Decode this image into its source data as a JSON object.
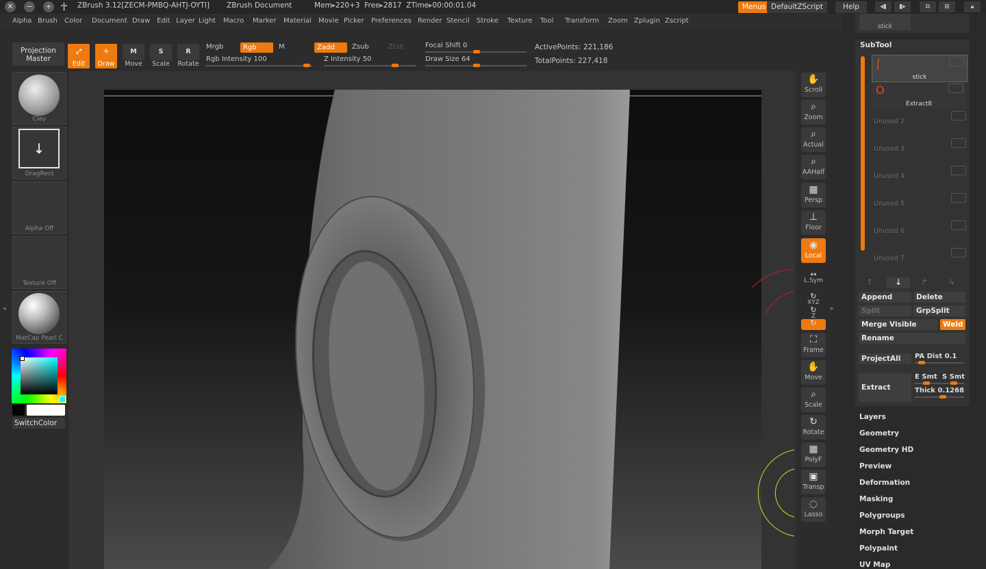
{
  "titlebar": {
    "app_title": "ZBrush 3.12[ZECM-PMBQ-AHTJ-OYTI]",
    "document": "ZBrush Document",
    "mem_label": "Mem",
    "mem_value": "220+3",
    "free_label": "Free",
    "free_value": "2817",
    "ztime_label": "ZTime",
    "ztime_value": "00:00:01.04",
    "menus_btn": "Menus",
    "script_btn": "DefaultZScript",
    "help_btn": "Help"
  },
  "menubar": [
    "Alpha",
    "Brush",
    "Color",
    "Document",
    "Draw",
    "Edit",
    "Layer",
    "Light",
    "Macro",
    "Marker",
    "Material",
    "Movie",
    "Picker",
    "Preferences",
    "Render",
    "Stencil",
    "Stroke",
    "Texture",
    "Tool",
    "Transform",
    "Zoom",
    "Zplugin",
    "Zscript"
  ],
  "shelf": {
    "projection_master": [
      "Projection",
      "Master"
    ],
    "tools": [
      {
        "label": "Edit",
        "glyph": "⤢",
        "active": true
      },
      {
        "label": "Draw",
        "glyph": "✛",
        "active": true
      },
      {
        "label": "Move",
        "glyph": "M",
        "active": false
      },
      {
        "label": "Scale",
        "glyph": "S",
        "active": false
      },
      {
        "label": "Rotate",
        "glyph": "R",
        "active": false
      }
    ],
    "mrgb": "Mrgb",
    "rgb": "Rgb",
    "m": "M",
    "zadd": "Zadd",
    "zsub": "Zsub",
    "zcut": "Zcut",
    "rgb_intensity_label": "Rgb Intensity",
    "rgb_intensity_value": "100",
    "z_intensity_label": "Z Intensity",
    "z_intensity_value": "50",
    "focal_shift_label": "Focal Shift",
    "focal_shift_value": "0",
    "draw_size_label": "Draw Size",
    "draw_size_value": "64",
    "active_points_label": "ActivePoints:",
    "active_points_value": "221,186",
    "total_points_label": "TotalPoints:",
    "total_points_value": "227,418"
  },
  "left_palette": {
    "brush": "Clay",
    "stroke": "DragRect",
    "alpha": "Alpha  Off",
    "texture": "Texture  Off",
    "material": "MatCap  Pearl  C",
    "switch_color": "SwitchColor"
  },
  "right_toolbar": [
    {
      "label": "Scroll",
      "glyph": "✋",
      "on": false
    },
    {
      "label": "Zoom",
      "glyph": "⌕",
      "on": false
    },
    {
      "label": "Actual",
      "glyph": "⌕",
      "on": false
    },
    {
      "label": "AAHalf",
      "glyph": "⌕",
      "on": false
    },
    {
      "label": "Persp",
      "glyph": "▦",
      "on": false
    },
    {
      "label": "Floor",
      "glyph": "⊥",
      "on": false
    },
    {
      "label": "Local",
      "glyph": "◉",
      "on": true
    },
    {
      "label": "L.Sym",
      "glyph": "↔",
      "on": false
    },
    {
      "label": "XYZ",
      "glyph": "↻",
      "on": false
    },
    {
      "label": "Z",
      "glyph": "↻",
      "on": false
    },
    {
      "label": "",
      "glyph": "↻",
      "on": true
    },
    {
      "label": "Frame",
      "glyph": "⛶",
      "on": false
    },
    {
      "label": "Move",
      "glyph": "✋",
      "on": false
    },
    {
      "label": "Scale",
      "glyph": "⌕",
      "on": false
    },
    {
      "label": "Rotate",
      "glyph": "↻",
      "on": false
    },
    {
      "label": "PolyF",
      "glyph": "▦",
      "on": false
    },
    {
      "label": "Transp",
      "glyph": "▣",
      "on": false
    },
    {
      "label": "Lasso",
      "glyph": "◌",
      "on": false
    }
  ],
  "subtool": {
    "top_label": "stick",
    "title": "SubTool",
    "items": [
      {
        "name": "stick",
        "active": true
      },
      {
        "name": "Extract8",
        "active": false
      }
    ],
    "unused": [
      "Unused 2",
      "Unused 3",
      "Unused 4",
      "Unused 5",
      "Unused 6",
      "Unused 7"
    ],
    "append": "Append",
    "delete": "Delete",
    "split": "Split",
    "grpsplit": "GrpSplit",
    "merge_visible": "Merge Visible",
    "weld": "Weld",
    "rename": "Rename",
    "project_all": "ProjectAll",
    "pa_dist_label": "PA Dist",
    "pa_dist_value": "0.1",
    "extract": "Extract",
    "e_smt": "E Smt",
    "s_smt": "S Smt",
    "thick_label": "Thick",
    "thick_value": "0.1268"
  },
  "sections": [
    "Layers",
    "Geometry",
    "Geometry HD",
    "Preview",
    "Deformation",
    "Masking",
    "Polygroups",
    "Morph Target",
    "Polypaint",
    "UV Map"
  ]
}
